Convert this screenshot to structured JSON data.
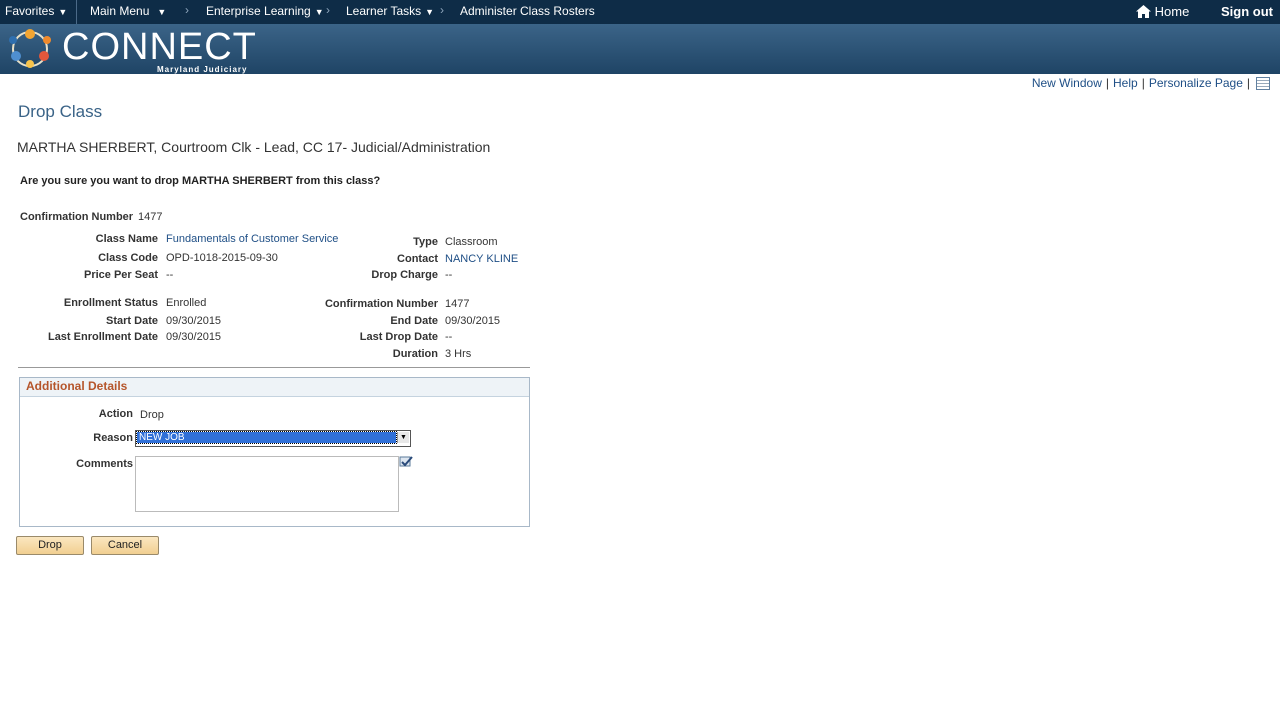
{
  "nav": {
    "favorites": "Favorites",
    "main_menu": "Main Menu",
    "breadcrumb": [
      "Enterprise Learning",
      "Learner Tasks",
      "Administer Class Rosters"
    ],
    "home": "Home",
    "sign_out": "Sign out"
  },
  "brand": {
    "name": "CONNECT",
    "tagline": "Maryland Judiciary"
  },
  "page_links": {
    "new_window": "New Window",
    "help": "Help",
    "personalize": "Personalize Page"
  },
  "page": {
    "title": "Drop Class",
    "learner": "MARTHA SHERBERT, Courtroom Clk - Lead, CC 17- Judicial/Administration",
    "question": "Are you sure you want to drop MARTHA SHERBERT from this class?"
  },
  "details": {
    "confirmation_label": "Confirmation Number",
    "confirmation_value": "1477",
    "class_name_label": "Class Name",
    "class_name_value": "Fundamentals of Customer Service",
    "class_code_label": "Class Code",
    "class_code_value": "OPD-1018-2015-09-30",
    "price_label": "Price Per Seat",
    "price_value": "--",
    "type_label": "Type",
    "type_value": "Classroom",
    "contact_label": "Contact",
    "contact_value": "NANCY KLINE",
    "drop_charge_label": "Drop Charge",
    "drop_charge_value": "--",
    "enroll_status_label": "Enrollment Status",
    "enroll_status_value": "Enrolled",
    "start_label": "Start Date",
    "start_value": "09/30/2015",
    "last_enroll_label": "Last Enrollment Date",
    "last_enroll_value": "09/30/2015",
    "conf2_label": "Confirmation Number",
    "conf2_value": "1477",
    "end_label": "End Date",
    "end_value": "09/30/2015",
    "last_drop_label": "Last Drop Date",
    "last_drop_value": "--",
    "duration_label": "Duration",
    "duration_value": "3 Hrs"
  },
  "additional": {
    "heading": "Additional Details",
    "action_label": "Action",
    "action_value": "Drop",
    "reason_label": "Reason",
    "reason_value": "NEW JOB",
    "comments_label": "Comments"
  },
  "buttons": {
    "drop": "Drop",
    "cancel": "Cancel"
  },
  "colors": {
    "nav_bg": "#0e2c47",
    "link": "#1f4f86",
    "section_heading": "#b5552b",
    "button_bg": "#f1cf91"
  }
}
